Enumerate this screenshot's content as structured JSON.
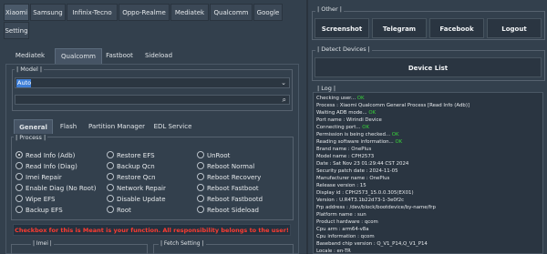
{
  "brand_tabs": [
    "Xiaomi",
    "Samsung",
    "Infinix-Tecno",
    "Oppo-Realme",
    "Mediatek",
    "Qualcomm",
    "Google"
  ],
  "setting_tab": "Setting",
  "sub_tabs": [
    "Mediatek",
    "Qualcomm",
    "Fastboot",
    "Sideload"
  ],
  "model_group": {
    "label": "| Model |",
    "selected": "Auto"
  },
  "function_tabs": [
    "General",
    "Flash",
    "Partition Manager",
    "EDL Service"
  ],
  "process": {
    "label": "| Process |",
    "col1": [
      "Read Info (Adb)",
      "Read Info (Diag)",
      "Imei Repair",
      "Enable Diag (No Root)",
      "Wipe EFS",
      "Backup EFS"
    ],
    "col2": [
      "Restore EFS",
      "Backup Qcn",
      "Restore Qcn",
      "Network Repair",
      "Disable Update",
      "Root"
    ],
    "col3": [
      "UnRoot",
      "Reboot Normal",
      "Reboot Recovery",
      "Reboot Fastboot",
      "Reboot Fastbootd",
      "Reboot Sideload"
    ]
  },
  "warning": "Checkbox for this is Meant is your function. All responsibility belongs to the user!",
  "bottom_groups": [
    "| Imei |",
    "| Fetch Setting |"
  ],
  "other": {
    "label": "| Other |",
    "buttons": [
      "Screenshot",
      "Telegram",
      "Facebook",
      "Logout"
    ]
  },
  "detect": {
    "label": "| Detect Devices |",
    "button": "Device List"
  },
  "log": {
    "label": "| Log |",
    "lines": [
      {
        "t": "Checking user... ",
        "s": "OK"
      },
      {
        "t": "Process : Xiaomi Qualcomm General Process [Read Info (Adb)]",
        "s": ""
      },
      {
        "t": "Waiting ADB mode... ",
        "s": "OK"
      },
      {
        "t": "Port name : Wirindi Device",
        "s": ""
      },
      {
        "t": "Connecting port... ",
        "s": "OK"
      },
      {
        "t": "Permission is being checked... ",
        "s": "OK"
      },
      {
        "t": "Reading software information... ",
        "s": "OK"
      },
      {
        "t": "Brand name : OnePlus",
        "s": ""
      },
      {
        "t": "Model name : CPH2573",
        "s": ""
      },
      {
        "t": "Date : Sat Nov 23 01:29:44 CST 2024",
        "s": ""
      },
      {
        "t": "Security patch date : 2024-11-05",
        "s": ""
      },
      {
        "t": "Manufacturer name : OnePlus",
        "s": ""
      },
      {
        "t": "Release version : 15",
        "s": ""
      },
      {
        "t": "Display id : CPH2573_15.0.0.305(EX01)",
        "s": ""
      },
      {
        "t": "Version : U.R4T3.1b22d73-1-3e0f2c",
        "s": ""
      },
      {
        "t": "Frp address : /dev/block/bootdevice/by-name/frp",
        "s": ""
      },
      {
        "t": "Platform name : sun",
        "s": ""
      },
      {
        "t": "Product hardware : qcom",
        "s": ""
      },
      {
        "t": "Cpu arm : arm64-v8a",
        "s": ""
      },
      {
        "t": "Cpu information : qcom",
        "s": ""
      },
      {
        "t": "Baseband chip version : Q_V1_P14,Q_V1_P14",
        "s": ""
      },
      {
        "t": "Locale : en-TR",
        "s": ""
      }
    ]
  }
}
